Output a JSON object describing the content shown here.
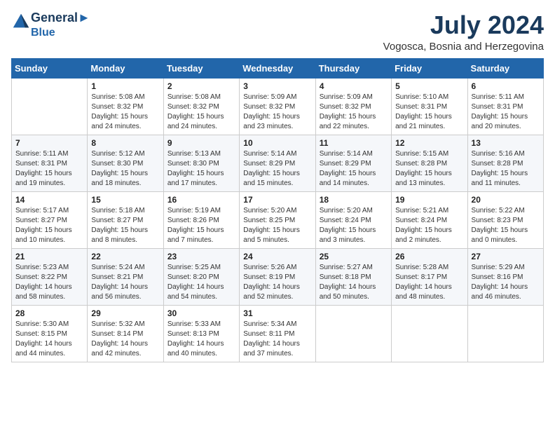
{
  "header": {
    "logo_line1": "General",
    "logo_line2": "Blue",
    "month": "July 2024",
    "location": "Vogosca, Bosnia and Herzegovina"
  },
  "days_of_week": [
    "Sunday",
    "Monday",
    "Tuesday",
    "Wednesday",
    "Thursday",
    "Friday",
    "Saturday"
  ],
  "weeks": [
    [
      {
        "day": "",
        "info": ""
      },
      {
        "day": "1",
        "info": "Sunrise: 5:08 AM\nSunset: 8:32 PM\nDaylight: 15 hours\nand 24 minutes."
      },
      {
        "day": "2",
        "info": "Sunrise: 5:08 AM\nSunset: 8:32 PM\nDaylight: 15 hours\nand 24 minutes."
      },
      {
        "day": "3",
        "info": "Sunrise: 5:09 AM\nSunset: 8:32 PM\nDaylight: 15 hours\nand 23 minutes."
      },
      {
        "day": "4",
        "info": "Sunrise: 5:09 AM\nSunset: 8:32 PM\nDaylight: 15 hours\nand 22 minutes."
      },
      {
        "day": "5",
        "info": "Sunrise: 5:10 AM\nSunset: 8:31 PM\nDaylight: 15 hours\nand 21 minutes."
      },
      {
        "day": "6",
        "info": "Sunrise: 5:11 AM\nSunset: 8:31 PM\nDaylight: 15 hours\nand 20 minutes."
      }
    ],
    [
      {
        "day": "7",
        "info": "Sunrise: 5:11 AM\nSunset: 8:31 PM\nDaylight: 15 hours\nand 19 minutes."
      },
      {
        "day": "8",
        "info": "Sunrise: 5:12 AM\nSunset: 8:30 PM\nDaylight: 15 hours\nand 18 minutes."
      },
      {
        "day": "9",
        "info": "Sunrise: 5:13 AM\nSunset: 8:30 PM\nDaylight: 15 hours\nand 17 minutes."
      },
      {
        "day": "10",
        "info": "Sunrise: 5:14 AM\nSunset: 8:29 PM\nDaylight: 15 hours\nand 15 minutes."
      },
      {
        "day": "11",
        "info": "Sunrise: 5:14 AM\nSunset: 8:29 PM\nDaylight: 15 hours\nand 14 minutes."
      },
      {
        "day": "12",
        "info": "Sunrise: 5:15 AM\nSunset: 8:28 PM\nDaylight: 15 hours\nand 13 minutes."
      },
      {
        "day": "13",
        "info": "Sunrise: 5:16 AM\nSunset: 8:28 PM\nDaylight: 15 hours\nand 11 minutes."
      }
    ],
    [
      {
        "day": "14",
        "info": "Sunrise: 5:17 AM\nSunset: 8:27 PM\nDaylight: 15 hours\nand 10 minutes."
      },
      {
        "day": "15",
        "info": "Sunrise: 5:18 AM\nSunset: 8:27 PM\nDaylight: 15 hours\nand 8 minutes."
      },
      {
        "day": "16",
        "info": "Sunrise: 5:19 AM\nSunset: 8:26 PM\nDaylight: 15 hours\nand 7 minutes."
      },
      {
        "day": "17",
        "info": "Sunrise: 5:20 AM\nSunset: 8:25 PM\nDaylight: 15 hours\nand 5 minutes."
      },
      {
        "day": "18",
        "info": "Sunrise: 5:20 AM\nSunset: 8:24 PM\nDaylight: 15 hours\nand 3 minutes."
      },
      {
        "day": "19",
        "info": "Sunrise: 5:21 AM\nSunset: 8:24 PM\nDaylight: 15 hours\nand 2 minutes."
      },
      {
        "day": "20",
        "info": "Sunrise: 5:22 AM\nSunset: 8:23 PM\nDaylight: 15 hours\nand 0 minutes."
      }
    ],
    [
      {
        "day": "21",
        "info": "Sunrise: 5:23 AM\nSunset: 8:22 PM\nDaylight: 14 hours\nand 58 minutes."
      },
      {
        "day": "22",
        "info": "Sunrise: 5:24 AM\nSunset: 8:21 PM\nDaylight: 14 hours\nand 56 minutes."
      },
      {
        "day": "23",
        "info": "Sunrise: 5:25 AM\nSunset: 8:20 PM\nDaylight: 14 hours\nand 54 minutes."
      },
      {
        "day": "24",
        "info": "Sunrise: 5:26 AM\nSunset: 8:19 PM\nDaylight: 14 hours\nand 52 minutes."
      },
      {
        "day": "25",
        "info": "Sunrise: 5:27 AM\nSunset: 8:18 PM\nDaylight: 14 hours\nand 50 minutes."
      },
      {
        "day": "26",
        "info": "Sunrise: 5:28 AM\nSunset: 8:17 PM\nDaylight: 14 hours\nand 48 minutes."
      },
      {
        "day": "27",
        "info": "Sunrise: 5:29 AM\nSunset: 8:16 PM\nDaylight: 14 hours\nand 46 minutes."
      }
    ],
    [
      {
        "day": "28",
        "info": "Sunrise: 5:30 AM\nSunset: 8:15 PM\nDaylight: 14 hours\nand 44 minutes."
      },
      {
        "day": "29",
        "info": "Sunrise: 5:32 AM\nSunset: 8:14 PM\nDaylight: 14 hours\nand 42 minutes."
      },
      {
        "day": "30",
        "info": "Sunrise: 5:33 AM\nSunset: 8:13 PM\nDaylight: 14 hours\nand 40 minutes."
      },
      {
        "day": "31",
        "info": "Sunrise: 5:34 AM\nSunset: 8:11 PM\nDaylight: 14 hours\nand 37 minutes."
      },
      {
        "day": "",
        "info": ""
      },
      {
        "day": "",
        "info": ""
      },
      {
        "day": "",
        "info": ""
      }
    ]
  ]
}
